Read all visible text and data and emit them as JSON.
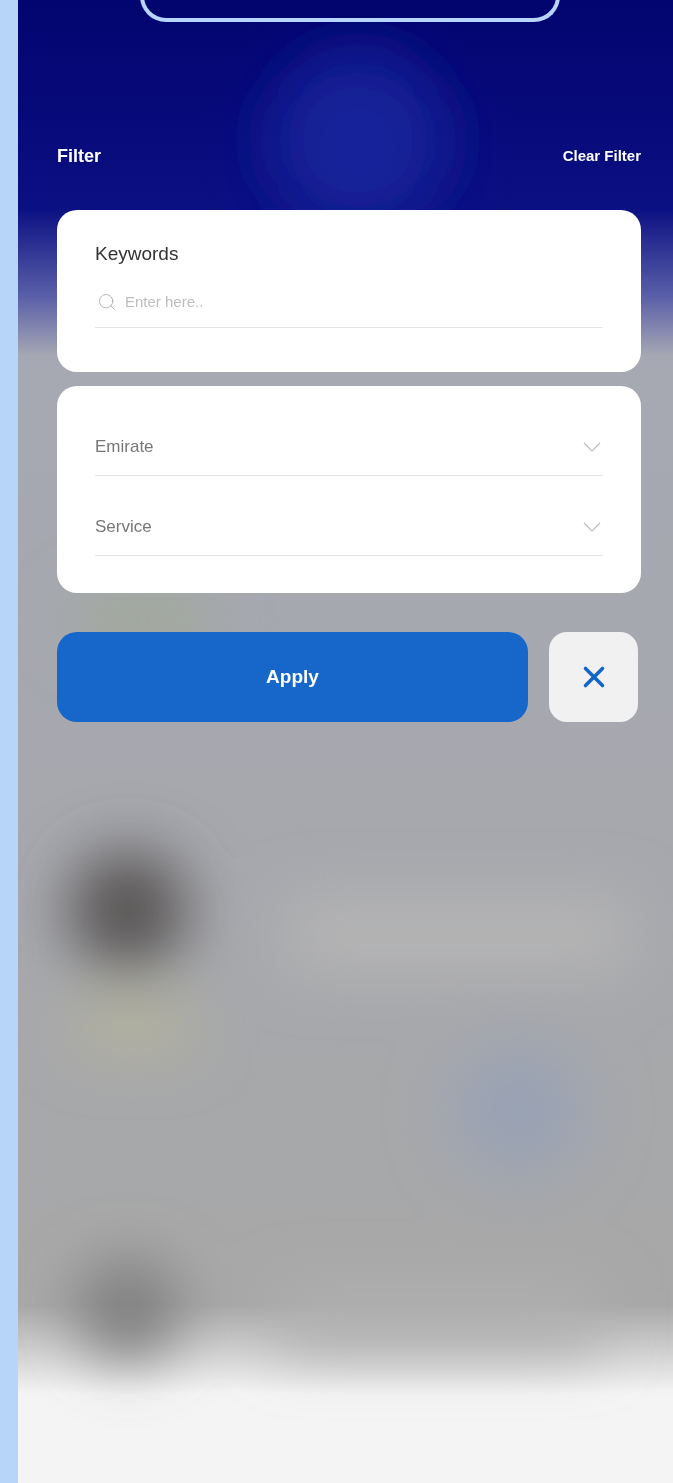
{
  "header": {
    "title": "Filter",
    "clear_button": "Clear Filter"
  },
  "keywords": {
    "label": "Keywords",
    "placeholder": "Enter here.."
  },
  "selects": [
    {
      "label": "Emirate"
    },
    {
      "label": "Service"
    }
  ],
  "apply_button": "Apply"
}
